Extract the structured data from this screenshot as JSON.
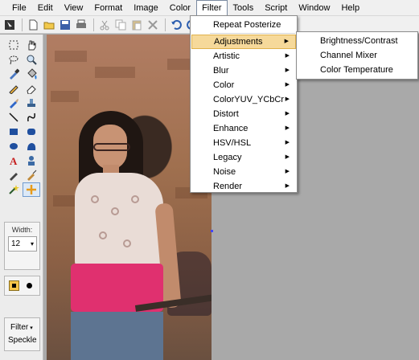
{
  "menubar": {
    "items": [
      "File",
      "Edit",
      "View",
      "Format",
      "Image",
      "Color",
      "Filter",
      "Tools",
      "Script",
      "Window",
      "Help"
    ],
    "active": "Filter"
  },
  "toolbar": {
    "icons": [
      "select-icon",
      "new-file-icon",
      "open-folder-icon",
      "save-icon",
      "print-icon",
      "cut-icon",
      "copy-icon",
      "paste-icon",
      "delete-icon",
      "undo-icon",
      "redo-icon",
      "zoom-in-icon",
      "zoom-out-icon"
    ]
  },
  "toolbox": {
    "tools": [
      "rect-select-icon",
      "hand-icon",
      "lasso-icon",
      "zoom-icon",
      "eyedropper-icon",
      "paint-bucket-icon",
      "pencil-icon",
      "eraser-icon",
      "brush-icon",
      "stamp-icon",
      "line-icon",
      "curve-icon",
      "rectangle-icon",
      "rounded-rect-icon",
      "ellipse-icon",
      "freeform-shape-icon",
      "text-icon",
      "clone-icon",
      "pen-icon",
      "smudge-icon",
      "magic-wand-icon",
      "move-icon"
    ],
    "width_label": "Width:",
    "width_value": "12",
    "filter_label": "Filter",
    "filter_value": "Speckle"
  },
  "filter_menu": {
    "repeat": "Repeat Posterize",
    "items": [
      "Adjustments",
      "Artistic",
      "Blur",
      "Color",
      "ColorYUV_YCbCr",
      "Distort",
      "Enhance",
      "HSV/HSL",
      "Legacy",
      "Noise",
      "Render"
    ],
    "highlighted": "Adjustments"
  },
  "adjustments_submenu": {
    "items": [
      "Brightness/Contrast",
      "Channel Mixer",
      "Color Temperature"
    ]
  }
}
